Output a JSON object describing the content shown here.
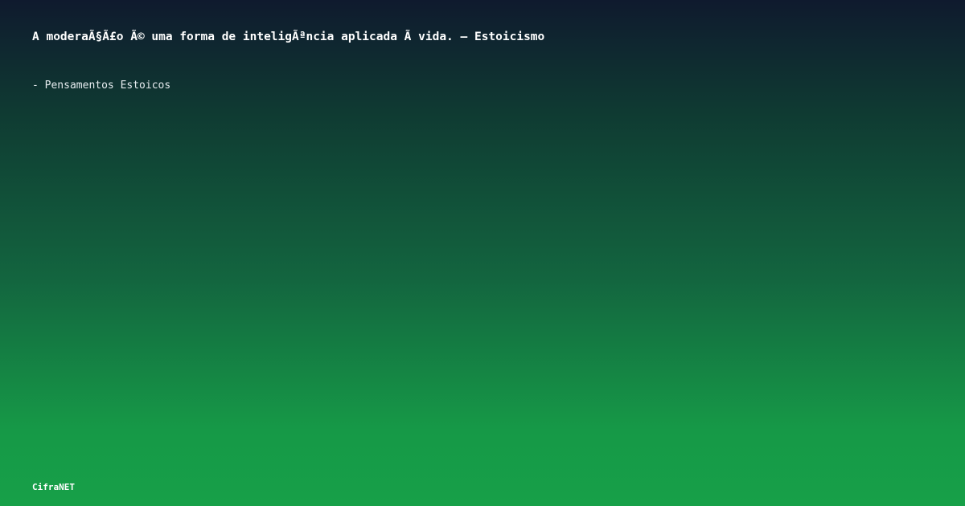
{
  "quote": {
    "text": "A moderaÃ§Ã£o Ã© uma forma de inteligÃªncia aplicada Ã  vida. — Estoicismo"
  },
  "attribution": {
    "text": "- Pensamentos Estoicos"
  },
  "brand": {
    "name": "CifraNET"
  },
  "colors": {
    "gradient_top": "#0f1a2e",
    "gradient_bottom": "#17a048",
    "text": "#ffffff"
  }
}
